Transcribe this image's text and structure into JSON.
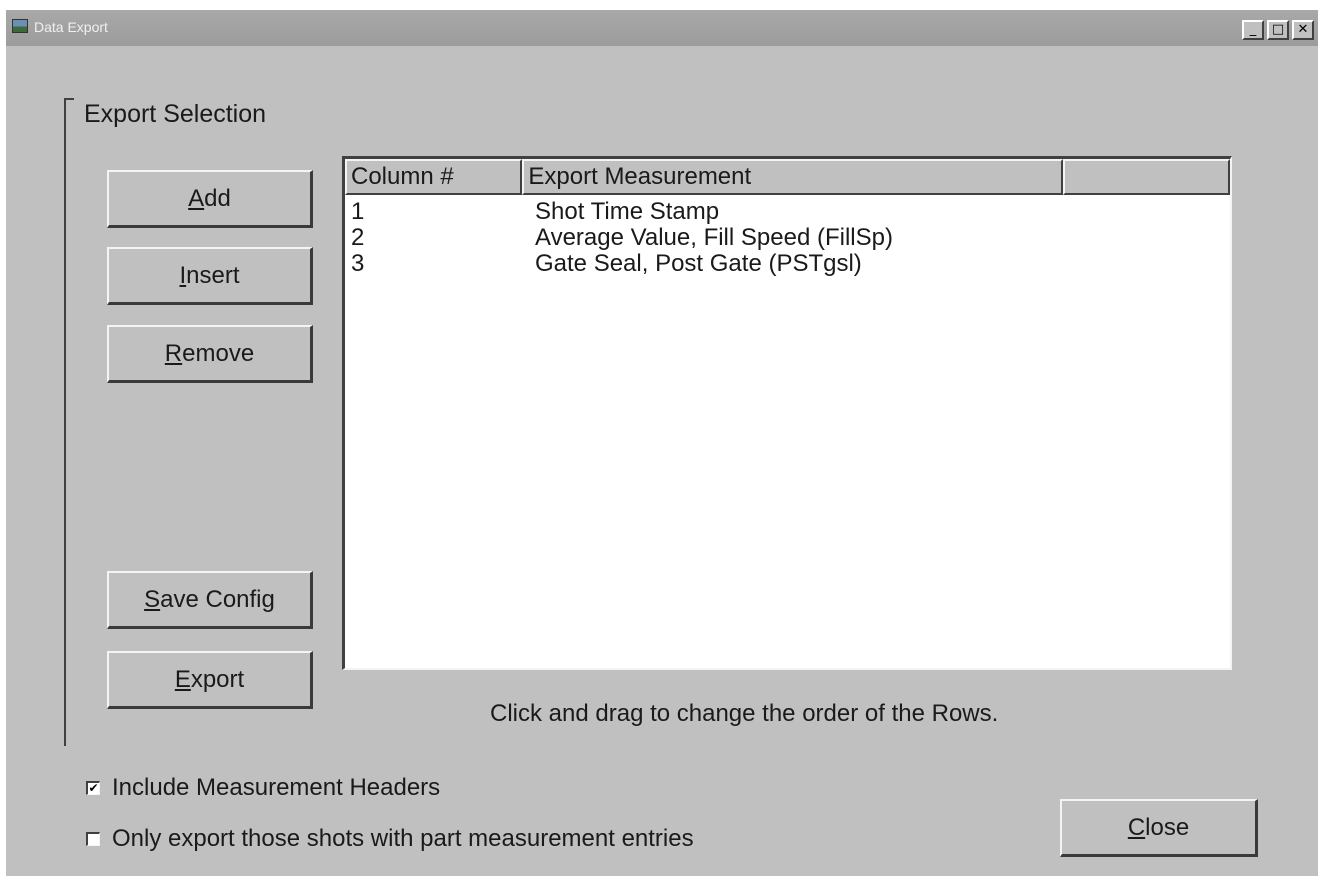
{
  "window": {
    "title": "Data Export",
    "controls": {
      "minimize": "_",
      "maximize": "□",
      "close": "✕"
    }
  },
  "export_selection": {
    "group_label": "Export Selection",
    "buttons": {
      "add": {
        "mnemonic": "A",
        "rest": "dd"
      },
      "insert": {
        "mnemonic": "I",
        "rest": "nsert"
      },
      "remove": {
        "mnemonic": "R",
        "rest": "emove"
      },
      "save_config": {
        "mnemonic": "S",
        "rest": "ave Config"
      },
      "export": {
        "mnemonic": "E",
        "rest": "xport"
      }
    },
    "list": {
      "columns": [
        "Column #",
        "Export Measurement",
        ""
      ],
      "rows": [
        {
          "column": "1",
          "measurement": "Shot Time Stamp"
        },
        {
          "column": "2",
          "measurement": "Average Value, Fill Speed (FillSp)"
        },
        {
          "column": "3",
          "measurement": "Gate Seal, Post Gate (PSTgsl)"
        }
      ]
    },
    "hint": "Click and drag to change the order of the Rows."
  },
  "options": {
    "include_headers": {
      "label": "Include Measurement Headers",
      "checked": true,
      "mark": "✔"
    },
    "only_part_entries": {
      "label": "Only export those shots with part measurement entries",
      "checked": false,
      "mark": ""
    }
  },
  "close_button": {
    "mnemonic": "C",
    "rest": "lose"
  }
}
